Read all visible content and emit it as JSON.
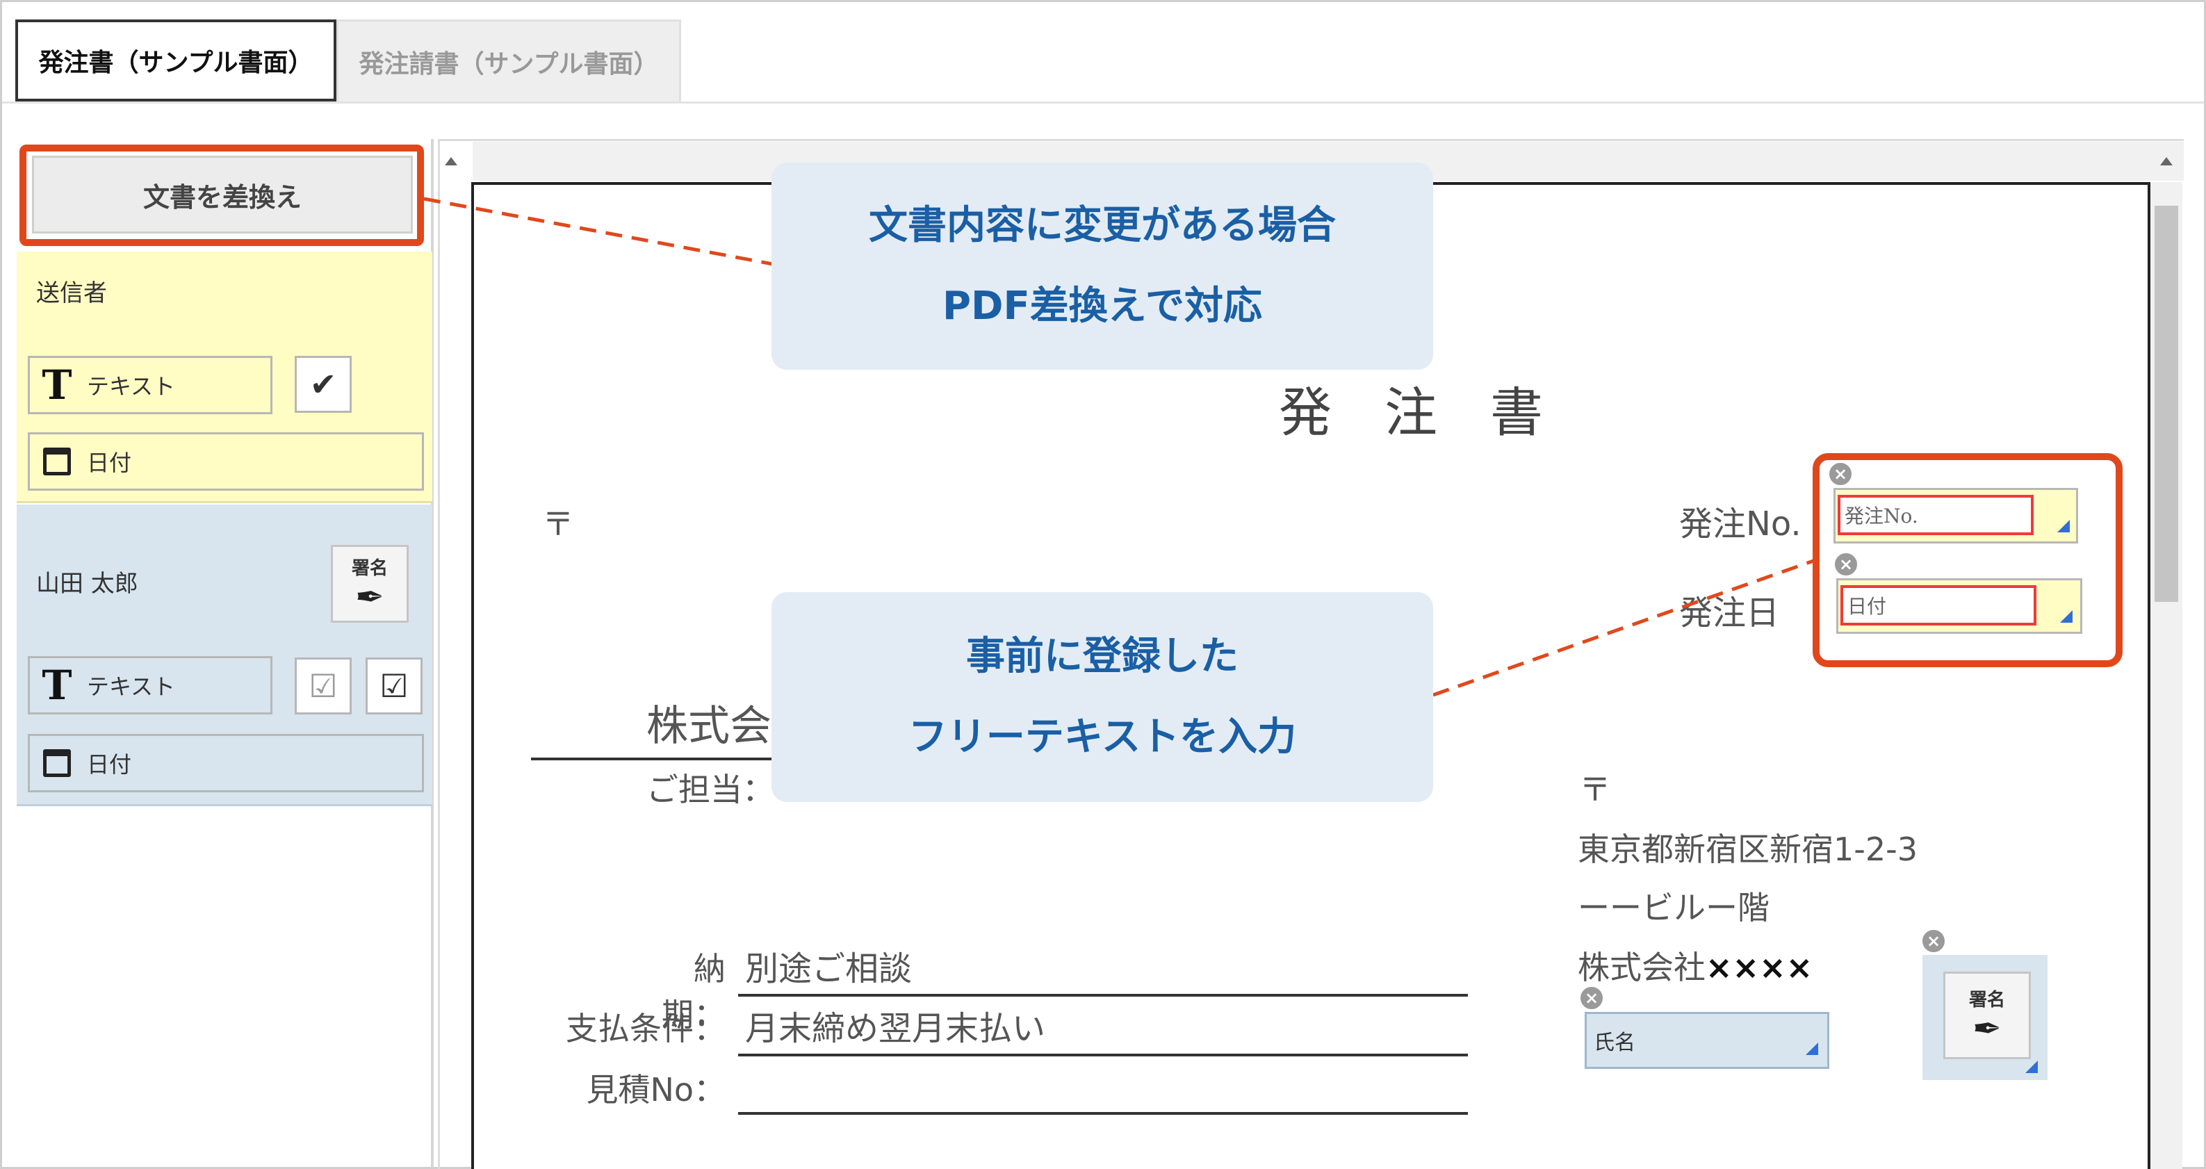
{
  "tabs": [
    {
      "label": "発注書（サンプル書面）",
      "active": true
    },
    {
      "label": "発注請書（サンプル書面）",
      "active": false
    }
  ],
  "sidebar": {
    "replace_button": "文書を差換え",
    "sender": {
      "label": "送信者",
      "text_field": "テキスト",
      "date_field": "日付"
    },
    "recipient": {
      "label": "山田 太郎",
      "signature_label": "署名",
      "text_field": "テキスト",
      "date_field": "日付"
    }
  },
  "document": {
    "title": "発　注　書",
    "postal_mark": "〒",
    "order_no_label": "発注No.",
    "order_date_label": "発注日",
    "company_fragment": "株式会",
    "contact_prefix": "ご担当：",
    "delivery_label": "納期：",
    "delivery_value": "別途ご相談",
    "payment_label": "支払条件：",
    "payment_value": "月末締め翌月末払い",
    "estimate_label": "見積No：",
    "sender_postal_mark": "〒",
    "sender_address1": "東京都新宿区新宿1-2-3",
    "sender_address2": "ーービルー階",
    "sender_company_prefix": "株式会社",
    "sender_company_suffix": "××××"
  },
  "form_fields": {
    "order_no_placeholder": "発注No.",
    "date_placeholder": "日付",
    "name_placeholder": "氏名",
    "signature_label": "署名",
    "remove_icon_glyph": "×"
  },
  "callouts": {
    "replace": [
      "文書内容に変更がある場合",
      "PDF差換えで対応"
    ],
    "freetext": [
      "事前に登録した",
      "フリーテキストを入力"
    ]
  },
  "colors": {
    "highlight_orange": "#e0481c",
    "callout_text": "#1a5fa5",
    "callout_bg": "#e3ecf5",
    "sender_bg": "#fffcc4",
    "recipient_bg": "#d8e5ef",
    "field_border_red": "#f03a3a"
  }
}
